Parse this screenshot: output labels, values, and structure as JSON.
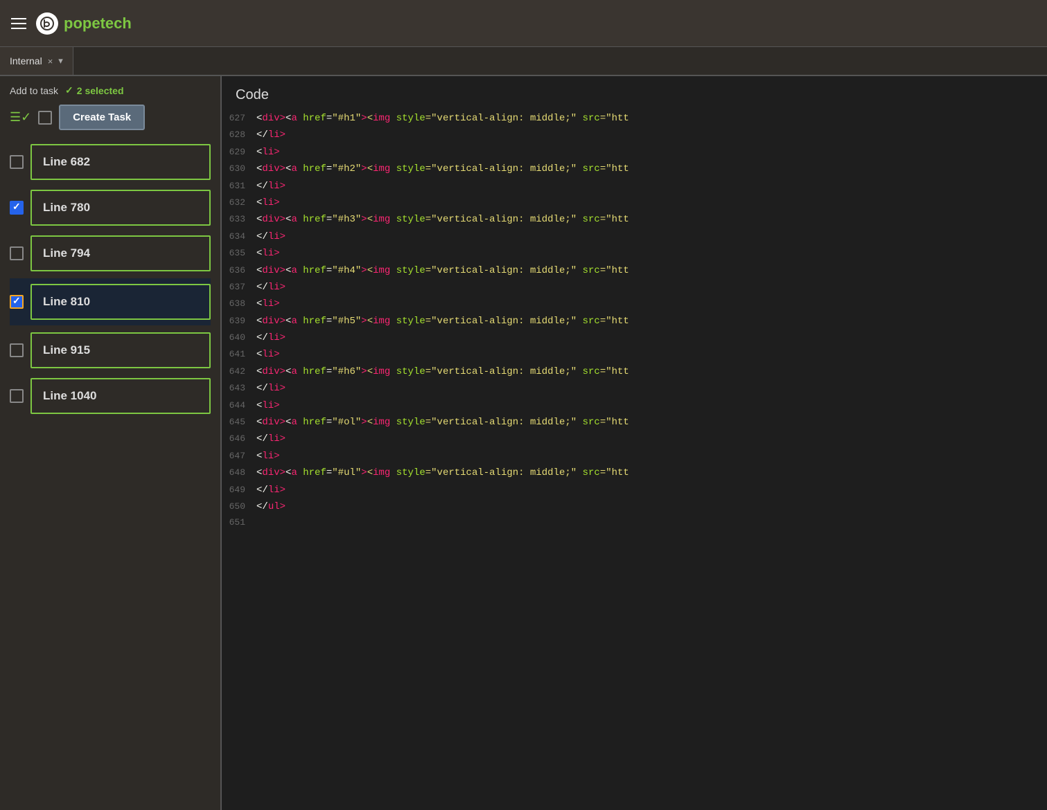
{
  "header": {
    "hamburger_label": "menu",
    "logo_initial": "p",
    "logo_name_prefix": "pope",
    "logo_name_suffix": "tech"
  },
  "tab_bar": {
    "tab_label": "Internal",
    "close_icon": "×",
    "dropdown_icon": "▾"
  },
  "left_panel": {
    "add_to_task_label": "Add to task",
    "selected_count_label": "2 selected",
    "create_task_label": "Create Task",
    "line_items": [
      {
        "id": "682",
        "label": "Line 682",
        "checked": false,
        "highlighted": false
      },
      {
        "id": "780",
        "label": "Line 780",
        "checked": true,
        "highlighted": false
      },
      {
        "id": "794",
        "label": "Line 794",
        "checked": false,
        "highlighted": false
      },
      {
        "id": "810",
        "label": "Line 810",
        "checked": true,
        "highlighted": true
      },
      {
        "id": "915",
        "label": "Line 915",
        "checked": false,
        "highlighted": false
      },
      {
        "id": "1040",
        "label": "Line 1040",
        "checked": false,
        "highlighted": false
      }
    ]
  },
  "code_panel": {
    "title": "Code",
    "lines": [
      {
        "num": 627,
        "indent": "            ",
        "html": "<div><a href=\"#h1\"><img style=\"vertical-align: middle;\" src=\"htt"
      },
      {
        "num": 628,
        "indent": "        ",
        "html": "</li>"
      },
      {
        "num": 629,
        "indent": "        ",
        "html": "<li>"
      },
      {
        "num": 630,
        "indent": "            ",
        "html": "<div><a href=\"#h2\"><img style=\"vertical-align: middle;\" src=\"htt"
      },
      {
        "num": 631,
        "indent": "        ",
        "html": "</li>"
      },
      {
        "num": 632,
        "indent": "        ",
        "html": "<li>"
      },
      {
        "num": 633,
        "indent": "            ",
        "html": "<div><a href=\"#h3\"><img style=\"vertical-align: middle;\" src=\"htt"
      },
      {
        "num": 634,
        "indent": "        ",
        "html": "</li>"
      },
      {
        "num": 635,
        "indent": "        ",
        "html": "<li>"
      },
      {
        "num": 636,
        "indent": "            ",
        "html": "<div><a href=\"#h4\"><img style=\"vertical-align: middle;\" src=\"htt"
      },
      {
        "num": 637,
        "indent": "        ",
        "html": "</li>"
      },
      {
        "num": 638,
        "indent": "        ",
        "html": "<li>"
      },
      {
        "num": 639,
        "indent": "            ",
        "html": "<div><a href=\"#h5\"><img style=\"vertical-align: middle;\" src=\"htt"
      },
      {
        "num": 640,
        "indent": "        ",
        "html": "</li>"
      },
      {
        "num": 641,
        "indent": "        ",
        "html": "<li>"
      },
      {
        "num": 642,
        "indent": "            ",
        "html": "<div><a href=\"#h6\"><img style=\"vertical-align: middle;\" src=\"htt"
      },
      {
        "num": 643,
        "indent": "        ",
        "html": "</li>"
      },
      {
        "num": 644,
        "indent": "        ",
        "html": "<li>"
      },
      {
        "num": 645,
        "indent": "            ",
        "html": "<div><a href=\"#ol\"><img style=\"vertical-align: middle;\" src=\"htt"
      },
      {
        "num": 646,
        "indent": "        ",
        "html": "</li>"
      },
      {
        "num": 647,
        "indent": "        ",
        "html": "<li>"
      },
      {
        "num": 648,
        "indent": "            ",
        "html": "<div><a href=\"#ul\"><img style=\"vertical-align: middle;\" src=\"htt"
      },
      {
        "num": 649,
        "indent": "        ",
        "html": "</li>"
      },
      {
        "num": 650,
        "indent": "",
        "html": "</ul>"
      },
      {
        "num": 651,
        "indent": "",
        "html": ""
      }
    ]
  }
}
